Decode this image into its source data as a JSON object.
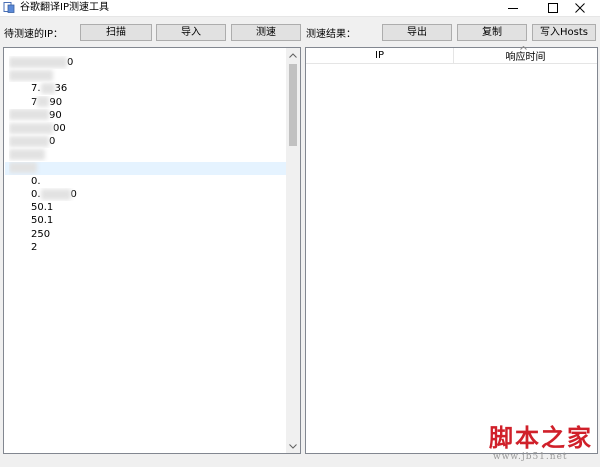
{
  "window": {
    "title": "谷歌翻译IP测速工具",
    "app_icon": "document-icon",
    "controls": {
      "minimize": "minimize-icon",
      "maximize": "maximize-icon",
      "close": "close-icon"
    }
  },
  "toolbar": {
    "pending_label": "待测速的IP：",
    "scan_label": "扫描",
    "import_label": "导入",
    "speedtest_label": "测速",
    "results_label": "测速结果：",
    "export_label": "导出",
    "copy_label": "复制",
    "write_hosts_label": "写入Hosts"
  },
  "ip_list": {
    "items": [
      {
        "visible": "",
        "tail": "0"
      },
      {
        "visible": "",
        "tail": ""
      },
      {
        "visible": "7.",
        "tail": "36"
      },
      {
        "visible": "7",
        "tail": "90"
      },
      {
        "visible": "",
        "tail": "90"
      },
      {
        "visible": "",
        "tail": "00"
      },
      {
        "visible": "",
        "tail": "0"
      },
      {
        "visible": "",
        "tail": ""
      },
      {
        "visible": "",
        "tail": ""
      },
      {
        "visible": "0.",
        "tail": ""
      },
      {
        "visible": "0.",
        "tail": "0"
      },
      {
        "visible": "50.1",
        "tail": ""
      },
      {
        "visible": "50.1",
        "tail": ""
      },
      {
        "visible": "250",
        "tail": ""
      },
      {
        "visible": "2",
        "tail": ""
      }
    ],
    "selected_index": 9
  },
  "results_table": {
    "columns": [
      "IP",
      "响应时间"
    ],
    "sorted_column": 1
  },
  "watermark": {
    "main": "脚本之家",
    "sub": "www.jb51.net"
  },
  "colors": {
    "window_bg": "#f0f0f0",
    "button_bg": "#e1e1e1",
    "selection": "#e5f3ff",
    "watermark": "#d0202a"
  }
}
